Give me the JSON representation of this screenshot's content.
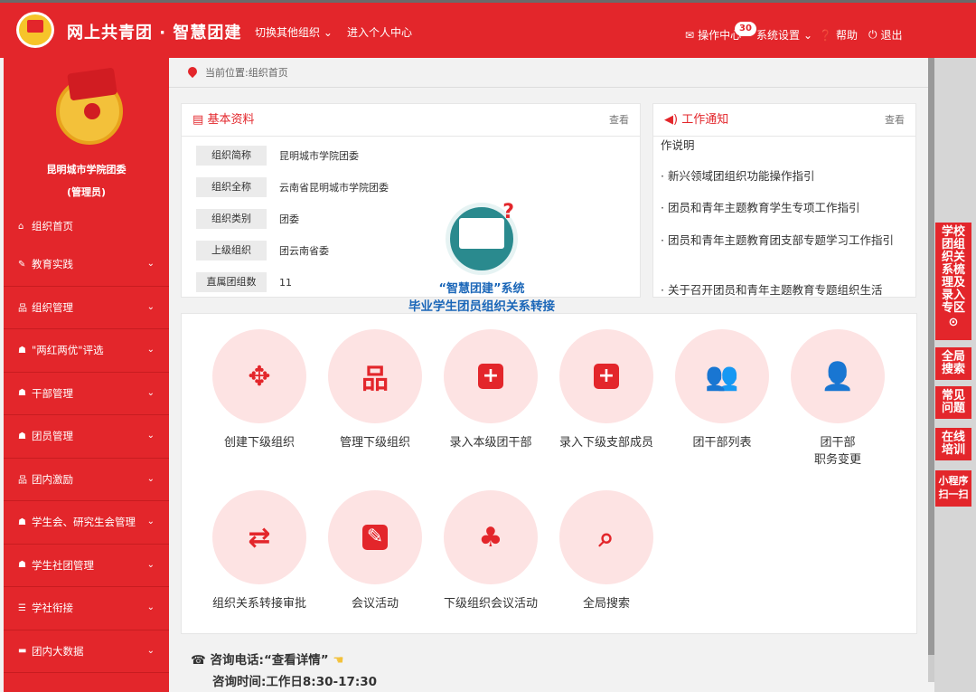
{
  "header": {
    "brand": "网上共青团 · 智慧团建",
    "switch_org": "切换其他组织",
    "personal_center": "进入个人中心",
    "ops_center": "操作中心",
    "ops_badge": "30",
    "settings": "系统设置",
    "help": "帮助",
    "logout": "退出"
  },
  "sidebar": {
    "org_name": "昆明城市学院团委",
    "role": "(管理员)",
    "items": [
      {
        "label": "组织首页",
        "icon": "home-icon"
      },
      {
        "label": "教育实践",
        "icon": "edit-icon"
      },
      {
        "label": "组织管理",
        "icon": "sitemap-icon"
      },
      {
        "label": "\"两红两优\"评选",
        "icon": "users-icon"
      },
      {
        "label": "干部管理",
        "icon": "users-icon"
      },
      {
        "label": "团员管理",
        "icon": "users-icon"
      },
      {
        "label": "团内激励",
        "icon": "sitemap-icon"
      },
      {
        "label": "学生会、研究生会管理",
        "icon": "users-icon"
      },
      {
        "label": "学生社团管理",
        "icon": "users-icon"
      },
      {
        "label": "学社衔接",
        "icon": "list-icon"
      },
      {
        "label": "团内大数据",
        "icon": "folder-icon"
      }
    ]
  },
  "breadcrumb": "当前位置:组织首页",
  "basic_info": {
    "title": "基本资料",
    "more": "查看",
    "rows": [
      {
        "label": "组织简称",
        "value": "昆明城市学院团委"
      },
      {
        "label": "组织全称",
        "value": "云南省昆明城市学院团委"
      },
      {
        "label": "组织类别",
        "value": "团委"
      },
      {
        "label": "上级组织",
        "value": "团云南省委"
      },
      {
        "label": "直属团组数",
        "value": "11"
      }
    ]
  },
  "notices": {
    "title": "工作通知",
    "more": "查看",
    "items": [
      "作说明",
      "· 新兴领域团组织功能操作指引",
      "· 团员和青年主题教育学生专项工作指引",
      "· 团员和青年主题教育团支部专题学习工作指引",
      "· 关于召开团员和青年主题教育专题组织生活"
    ]
  },
  "promo": {
    "line1": "“智慧团建”系统",
    "line2": "毕业学生团员组织关系转接"
  },
  "tiles": [
    {
      "label": "创建下级组织",
      "icon": "move-icon"
    },
    {
      "label": "管理下级组织",
      "icon": "sitemap-icon"
    },
    {
      "label": "录入本级团干部",
      "icon": "plus-square-icon"
    },
    {
      "label": "录入下级支部成员",
      "icon": "plus-square-icon"
    },
    {
      "label": "团干部列表",
      "icon": "users-icon"
    },
    {
      "label": "团干部",
      "label2": "职务变更",
      "icon": "user-icon"
    },
    {
      "label": "组织关系转接审批",
      "icon": "retweet-icon"
    },
    {
      "label": "会议活动",
      "icon": "edit-square-icon"
    },
    {
      "label": "下级组织会议活动",
      "icon": "tree-icon"
    },
    {
      "label": "全局搜索",
      "icon": "search-icon"
    }
  ],
  "contact": {
    "phone_label": "咨询电话:",
    "phone_link": "“查看详情”",
    "time": "咨询时间:工作日8:30-17:30"
  },
  "float": {
    "transfer": "学校团组织关系梳理及录入专区",
    "search": "全局搜索",
    "faq": "常见问题",
    "training": "在线培训",
    "miniapp": "小程序扫一扫"
  }
}
